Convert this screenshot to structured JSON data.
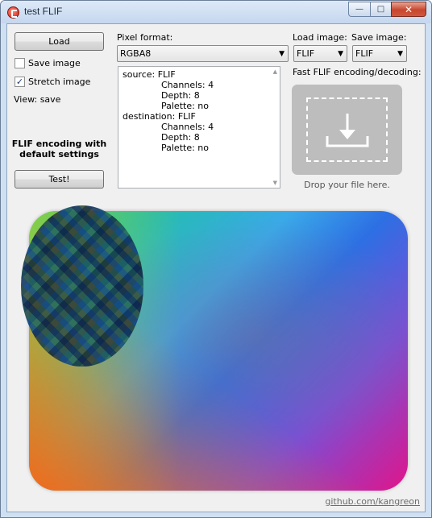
{
  "window": {
    "title": "test FLIF",
    "minimize_glyph": "—",
    "maximize_glyph": "□",
    "close_glyph": "✕"
  },
  "left_panel": {
    "load_label": "Load",
    "save_image_label": "Save image",
    "save_image_checked": false,
    "stretch_image_label": "Stretch image",
    "stretch_image_checked": true,
    "view_label": "View: save",
    "encoding_info_line1": "FLIF encoding with",
    "encoding_info_line2": "default settings",
    "test_label": "Test!"
  },
  "pixel_format": {
    "label": "Pixel format:",
    "value": "RGBA8"
  },
  "load_image": {
    "label": "Load image:",
    "value": "FLIF"
  },
  "save_image": {
    "label": "Save image:",
    "value": "FLIF"
  },
  "info_text": {
    "source": "source: FLIF",
    "source_channels": "Channels: 4",
    "source_depth": "Depth: 8",
    "source_palette": "Palette: no",
    "destination": "destination: FLIF",
    "dest_channels": "Channels: 4",
    "dest_depth": "Depth: 8",
    "dest_palette": "Palette: no"
  },
  "dropzone": {
    "caption_top": "Fast FLIF encoding/decoding:",
    "caption_bottom": "Drop your file here.",
    "icon": "download-arrow-icon"
  },
  "footer": {
    "link": "github.com/kangreon"
  },
  "colors": {
    "accent_checkbox": "#1e3a6b",
    "dropzone_bg": "#bdbdbd",
    "link": "#6d6d6d"
  }
}
